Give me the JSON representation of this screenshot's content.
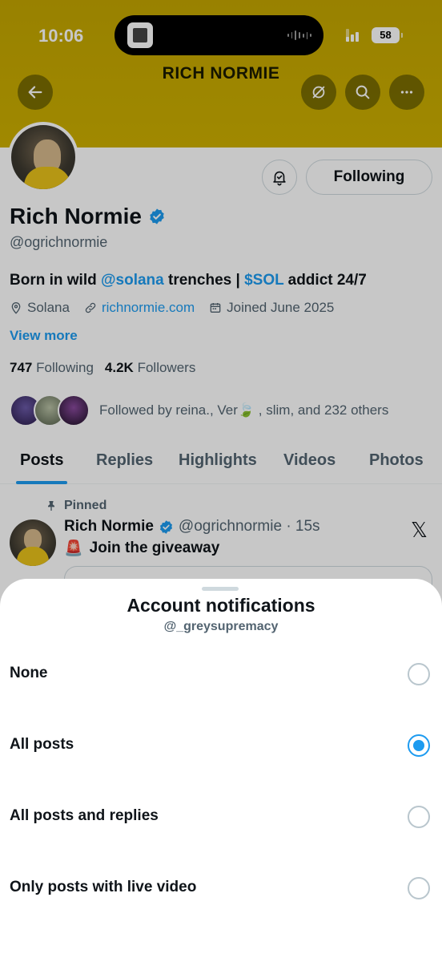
{
  "status_bar": {
    "time": "10:06",
    "battery": "58"
  },
  "header": {
    "title": "RICH NORMIE"
  },
  "profile": {
    "name": "Rich Normie",
    "handle": "@ogrichnormie",
    "following_button": "Following",
    "bio": {
      "prefix": "Born in wild ",
      "mention": "@solana",
      "middle": " trenches | ",
      "cashtag": "$SOL",
      "suffix": " addict 24/7"
    },
    "location": "Solana",
    "website": "richnormie.com",
    "joined": "Joined June 2025",
    "view_more": "View more",
    "following_count": "747",
    "following_label": "Following",
    "followers_count": "4.2K",
    "followers_label": "Followers",
    "followed_by": "Followed by reina., Ver🍃 , slim, and 232 others"
  },
  "tabs": [
    {
      "label": "Posts"
    },
    {
      "label": "Replies"
    },
    {
      "label": "Highlights"
    },
    {
      "label": "Videos"
    },
    {
      "label": "Photos"
    }
  ],
  "active_tab": "Posts",
  "pinned_post": {
    "pinned_label": "Pinned",
    "author": "Rich Normie",
    "handle_time": "@ogrichnormie · 15s",
    "emoji": "🚨",
    "text": "Join the giveaway",
    "x_logo": "𝕏"
  },
  "sheet": {
    "title": "Account notifications",
    "subtitle": "@_greysupremacy",
    "options": [
      {
        "label": "None",
        "selected": false
      },
      {
        "label": "All posts",
        "selected": true
      },
      {
        "label": "All posts and replies",
        "selected": false
      },
      {
        "label": "Only posts with live video",
        "selected": false
      }
    ]
  },
  "colors": {
    "accent": "#1d9bf0",
    "banner": "#c9ab00",
    "text": "#0f1419",
    "secondary": "#536471"
  }
}
